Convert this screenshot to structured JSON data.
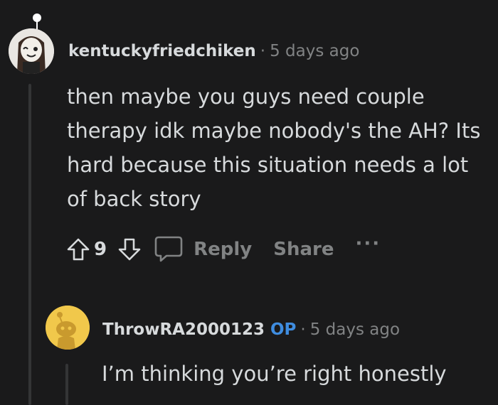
{
  "comment": {
    "username": "kentuckyfriedchiken",
    "separator": "·",
    "timestamp": "5 days ago",
    "body": "then maybe you guys need couple therapy idk maybe nobody's the AH? Its hard because this situation needs a lot of back story",
    "score": "9",
    "actions": {
      "reply_label": "Reply",
      "share_label": "Share",
      "more_label": "···"
    }
  },
  "reply": {
    "username": "ThrowRA2000123",
    "badge": "OP",
    "separator": "·",
    "timestamp": "5 days ago",
    "body": "I’m thinking you’re right honestly"
  },
  "colors": {
    "background": "#1a1a1b",
    "text": "#d7dadc",
    "muted": "#818384",
    "op_badge": "#3f8de0",
    "thread_line": "#343536",
    "reply_avatar": "#f1c84b"
  },
  "icons": {
    "upvote": "arrow-up-outline-icon",
    "downvote": "arrow-down-outline-icon",
    "reply": "speech-bubble-icon",
    "more": "ellipsis-icon"
  }
}
